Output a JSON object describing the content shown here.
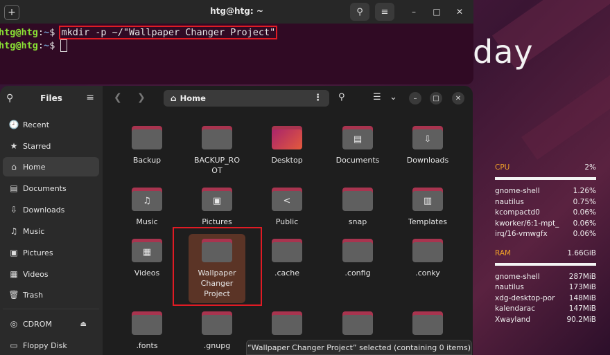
{
  "desktop": {
    "clock_fragment": "day"
  },
  "terminal": {
    "title": "htg@htg: ~",
    "lines": [
      {
        "user": "htg@htg",
        "sep": ":",
        "path": "~",
        "dollar": "$ ",
        "command": "mkdir -p ~/\"Wallpaper Changer Project\""
      },
      {
        "user": "htg@htg",
        "sep": ":",
        "path": "~",
        "dollar": "$ ",
        "command": ""
      }
    ]
  },
  "files": {
    "app_title": "Files",
    "sidebar": [
      {
        "icon": "clock-icon",
        "glyph": "🕘",
        "label": "Recent"
      },
      {
        "icon": "star-icon",
        "glyph": "★",
        "label": "Starred"
      },
      {
        "icon": "home-icon",
        "glyph": "⌂",
        "label": "Home"
      },
      {
        "icon": "document-icon",
        "glyph": "▤",
        "label": "Documents"
      },
      {
        "icon": "download-icon",
        "glyph": "⇩",
        "label": "Downloads"
      },
      {
        "icon": "music-icon",
        "glyph": "♫",
        "label": "Music"
      },
      {
        "icon": "picture-icon",
        "glyph": "▣",
        "label": "Pictures"
      },
      {
        "icon": "video-icon",
        "glyph": "▦",
        "label": "Videos"
      },
      {
        "icon": "trash-icon",
        "glyph": "🗑",
        "label": "Trash"
      },
      {
        "icon": "disc-icon",
        "glyph": "◎",
        "label": "CDROM"
      },
      {
        "icon": "floppy-icon",
        "glyph": "▭",
        "label": "Floppy Disk"
      }
    ],
    "path": "Home",
    "items": [
      {
        "name": "Backup",
        "icon": ""
      },
      {
        "name": "BACKUP_RO\nOT",
        "icon": ""
      },
      {
        "name": "Desktop",
        "icon": ""
      },
      {
        "name": "Documents",
        "icon": "▤"
      },
      {
        "name": "Downloads",
        "icon": "⇩"
      },
      {
        "name": "Music",
        "icon": "♫"
      },
      {
        "name": "Pictures",
        "icon": "▣"
      },
      {
        "name": "Public",
        "icon": "<"
      },
      {
        "name": "snap",
        "icon": ""
      },
      {
        "name": "Templates",
        "icon": "▥"
      },
      {
        "name": "Videos",
        "icon": "▦"
      },
      {
        "name": "Wallpaper\nChanger\nProject",
        "icon": ""
      },
      {
        "name": ".cache",
        "icon": ""
      },
      {
        "name": ".config",
        "icon": ""
      },
      {
        "name": ".conky",
        "icon": ""
      },
      {
        "name": ".fonts",
        "icon": ""
      },
      {
        "name": ".gnupg",
        "icon": ""
      },
      {
        "name": "",
        "icon": ""
      },
      {
        "name": "",
        "icon": ""
      },
      {
        "name": "",
        "icon": ""
      }
    ],
    "status": "“Wallpaper Changer Project” selected  (containing 0 items)"
  },
  "conky": {
    "cpu": {
      "label": "CPU",
      "value": "2%",
      "usage_fraction": 0.02
    },
    "cpu_procs": [
      {
        "name": "gnome-shell",
        "value": "1.26%"
      },
      {
        "name": "nautilus",
        "value": "0.75%"
      },
      {
        "name": "kcompactd0",
        "value": "0.06%"
      },
      {
        "name": "kworker/6:1-mpt_",
        "value": "0.06%"
      },
      {
        "name": "irq/16-vmwgfx",
        "value": "0.06%"
      }
    ],
    "ram": {
      "label": "RAM",
      "value": "1.66GiB"
    },
    "ram_procs": [
      {
        "name": "gnome-shell",
        "value": "287MiB"
      },
      {
        "name": "nautilus",
        "value": "173MiB"
      },
      {
        "name": "xdg-desktop-por",
        "value": "148MiB"
      },
      {
        "name": "kalendarac",
        "value": "147MiB"
      },
      {
        "name": "Xwayland",
        "value": "90.2MiB"
      }
    ]
  },
  "colors": {
    "accent_red": "#e01b24",
    "folder_tab": "#a8344f",
    "prompt_green": "#8ae234",
    "prompt_blue": "#729fcf",
    "conky_orange": "#f0a028"
  }
}
